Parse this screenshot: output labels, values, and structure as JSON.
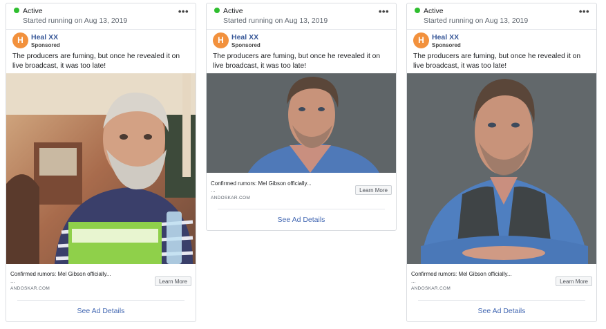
{
  "colors": {
    "active_dot": "#2fbe2f",
    "avatar_bg": "#f2913d",
    "link_blue": "#385898",
    "cta_blue": "#4267b2"
  },
  "cards": [
    {
      "status": "Active",
      "started": "Started running on Aug 13, 2019",
      "more_icon": "•••",
      "avatar_letter": "H",
      "page_name": "Heal XX",
      "sponsored": "Sponsored",
      "body_text": "The producers are fuming, but once he revealed it on live broadcast, it was too late!",
      "image_desc": "Photo of an older bearded man in a striped polo shirt outdoors",
      "link_title": "Confirmed rumors: Mel Gibson officially...",
      "link_desc": "...",
      "domain": "ANDOSKAR.COM",
      "cta": "Learn More",
      "see_details": "See Ad Details"
    },
    {
      "status": "Active",
      "started": "Started running on Aug 13, 2019",
      "more_icon": "•••",
      "avatar_letter": "H",
      "page_name": "Heal XX",
      "sponsored": "Sponsored",
      "body_text": "The producers are fuming, but once he revealed it on live broadcast, it was too late!",
      "image_desc": "Portrait of a man in a blue shirt against a gray background",
      "link_title": "Confirmed rumors: Mel Gibson officially...",
      "link_desc": "...",
      "domain": "ANDOSKAR.COM",
      "cta": "Learn More",
      "see_details": "See Ad Details"
    },
    {
      "status": "Active",
      "started": "Started running on Aug 13, 2019",
      "more_icon": "•••",
      "avatar_letter": "H",
      "page_name": "Heal XX",
      "sponsored": "Sponsored",
      "body_text": "The producers are fuming, but once he revealed it on live broadcast, it was too late!",
      "image_desc": "Portrait of a man in a blue shirt and dark vest with crossed arms",
      "link_title": "Confirmed rumors: Mel Gibson officially...",
      "link_desc": "...",
      "domain": "ANDOSKAR.COM",
      "cta": "Learn More",
      "see_details": "See Ad Details"
    }
  ]
}
